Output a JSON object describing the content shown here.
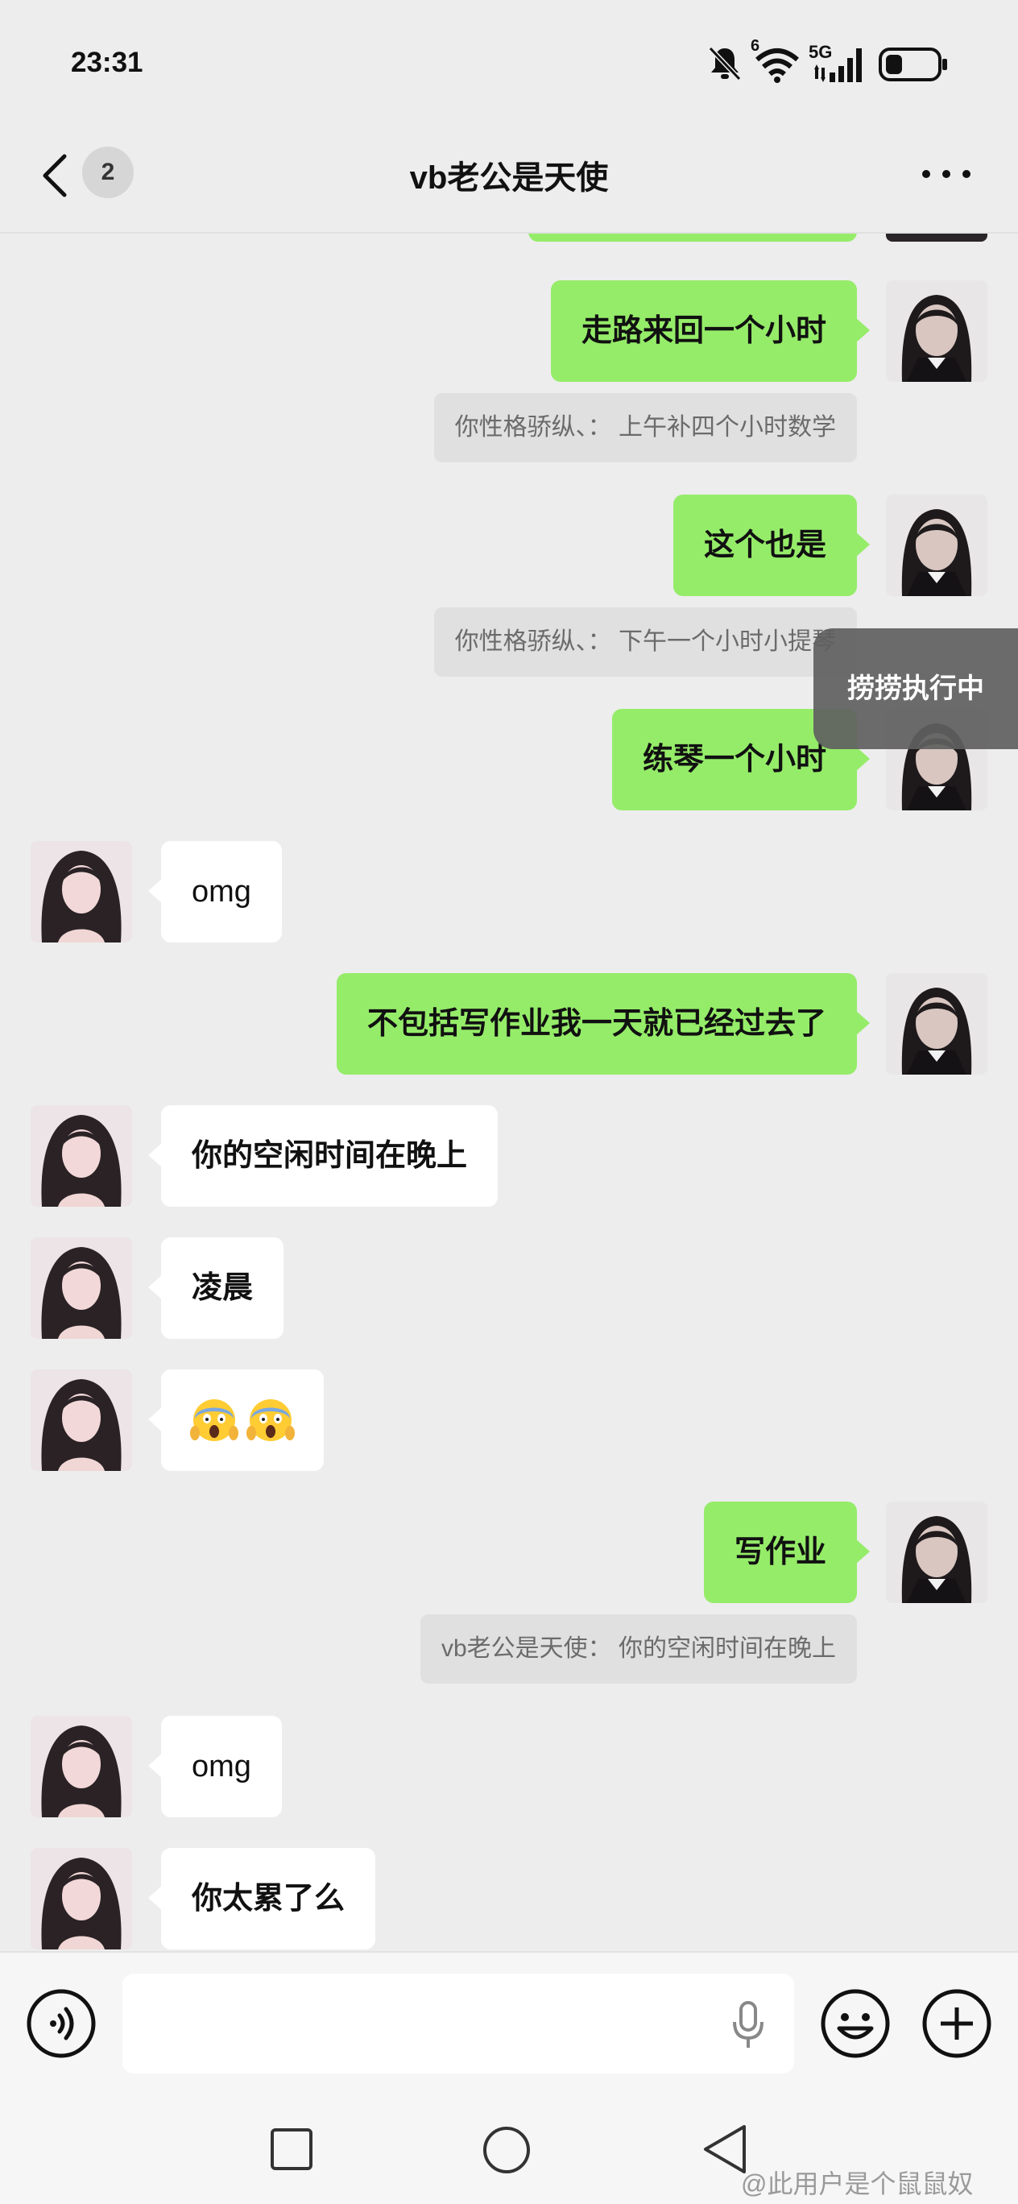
{
  "status_bar": {
    "time": "23:31",
    "icons": [
      "mute-bell-icon",
      "wifi-icon",
      "signal-5g-icon",
      "battery-icon"
    ],
    "wifi_superscript": "6",
    "network_label": "5G"
  },
  "header": {
    "back_count": "2",
    "title": "vb老公是天使",
    "more_icon": "more-dots-icon"
  },
  "messages": [
    {
      "side": "me",
      "text": "走路来回一个小时"
    },
    {
      "type": "quote",
      "text": "你性格骄纵、：  上午补四个小时数学"
    },
    {
      "side": "me",
      "text": "这个也是"
    },
    {
      "type": "quote",
      "text": "你性格骄纵、：  下午一个小时小提琴"
    },
    {
      "side": "me",
      "text": "练琴一个小时"
    },
    {
      "side": "them",
      "text": "omg"
    },
    {
      "side": "me",
      "text": "不包括写作业我一天就已经过去了"
    },
    {
      "side": "them",
      "text": "你的空闲时间在晚上"
    },
    {
      "side": "them",
      "text": "凌晨"
    },
    {
      "side": "them",
      "text": "😱😱"
    },
    {
      "side": "me",
      "text": "写作业"
    },
    {
      "type": "quote",
      "text": "vb老公是天使：  你的空闲时间在晚上"
    },
    {
      "side": "them",
      "text": "omg"
    },
    {
      "side": "them",
      "text": "你太累了么"
    }
  ],
  "floating_status": {
    "text": "捞捞执行中"
  },
  "input_bar": {
    "voice_icon": "voice-toggle-icon",
    "mic_icon": "microphone-icon",
    "emoji_icon": "emoji-icon",
    "plus_icon": "plus-icon"
  },
  "watermark": {
    "text": "@此用户是个鼠鼠奴"
  },
  "colors": {
    "background": "#ededed",
    "my_bubble": "#95ec69",
    "their_bubble": "#ffffff",
    "quote_bg": "#e0e0e0"
  }
}
